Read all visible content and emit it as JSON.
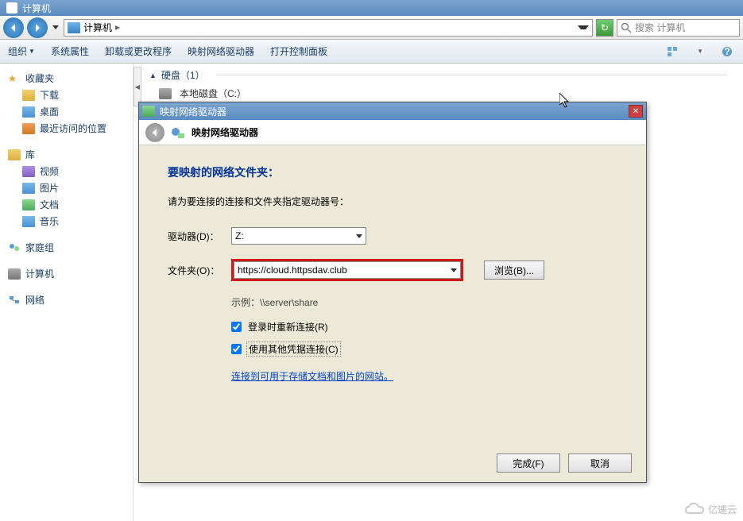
{
  "window": {
    "title": "计算机"
  },
  "nav": {
    "address_label": "计算机",
    "search_placeholder": "搜索 计算机"
  },
  "toolbar": {
    "organize": "组织",
    "sysprops": "系统属性",
    "uninstall": "卸载或更改程序",
    "map_drive": "映射网络驱动器",
    "ctrl_panel": "打开控制面板"
  },
  "sidebar": {
    "favorites": {
      "label": "收藏夹",
      "items": [
        "下载",
        "桌面",
        "最近访问的位置"
      ]
    },
    "libraries": {
      "label": "库",
      "items": [
        "视频",
        "图片",
        "文档",
        "音乐"
      ]
    },
    "homegroup": "家庭组",
    "computer": "计算机",
    "network": "网络"
  },
  "content": {
    "disk_header": "硬盘（1）",
    "disk_name": "本地磁盘（C:）"
  },
  "dialog": {
    "title": "映射网络驱动器",
    "header_title": "映射网络驱动器",
    "heading": "要映射的网络文件夹：",
    "description": "请为要连接的连接和文件夹指定驱动器号：",
    "drive_label": "驱动器(D)：",
    "drive_value": "Z:",
    "folder_label": "文件夹(O)：",
    "folder_value": "https://cloud.httpsdav.club",
    "browse_label": "浏览(B)...",
    "example": "示例：\\\\server\\share",
    "reconnect": "登录时重新连接(R)",
    "other_creds": "使用其他凭据连接(C)",
    "storage_link": "连接到可用于存储文档和图片的网站。",
    "finish": "完成(F)",
    "cancel": "取消"
  },
  "watermark": "亿速云"
}
